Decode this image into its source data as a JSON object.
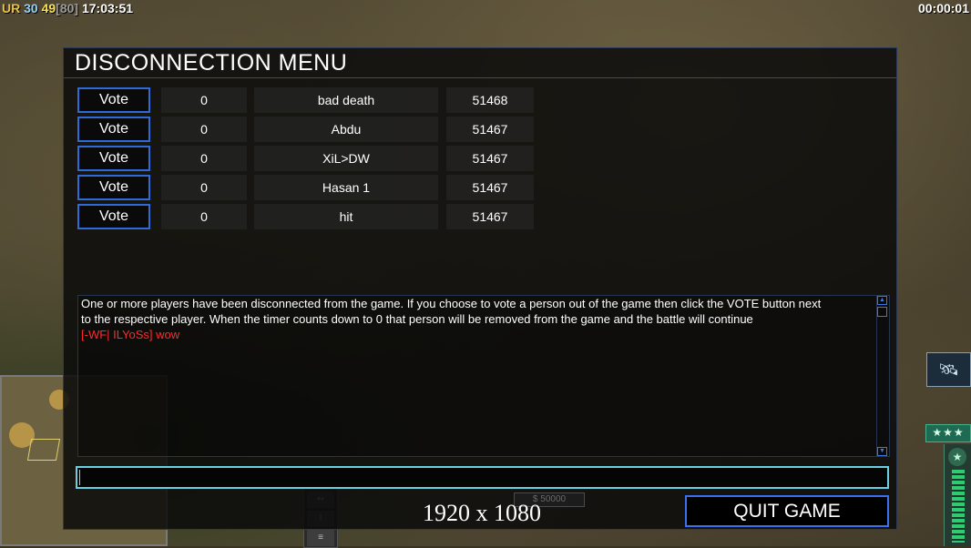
{
  "hud": {
    "ur_label": "UR",
    "stat_a": "30",
    "stat_b": "49",
    "stat_c": "[80]",
    "clock": "17:03:51",
    "timer": "00:00:01"
  },
  "menu": {
    "title": "DISCONNECTION MENU",
    "vote_label": "Vote",
    "players": [
      {
        "votes": "0",
        "name": "bad death",
        "ping": "51468"
      },
      {
        "votes": "0",
        "name": "Abdu",
        "ping": "51467"
      },
      {
        "votes": "0",
        "name": "XiL>DW",
        "ping": "51467"
      },
      {
        "votes": "0",
        "name": "Hasan 1",
        "ping": "51467"
      },
      {
        "votes": "0",
        "name": "hit",
        "ping": "51467"
      }
    ],
    "message_line1": "One or more players have been disconnected from the game. If you choose to vote a person out of the game then click the VOTE button next",
    "message_line2": " to the respective player. When the timer counts down to 0 that person will be removed from the game and the battle will continue",
    "chat_line": "[-WF| ILYoSs] wow",
    "resolution": "1920 x 1080",
    "quit_label": "QUIT GAME"
  },
  "background": {
    "money": "$ 50000",
    "stars": "★★★"
  }
}
